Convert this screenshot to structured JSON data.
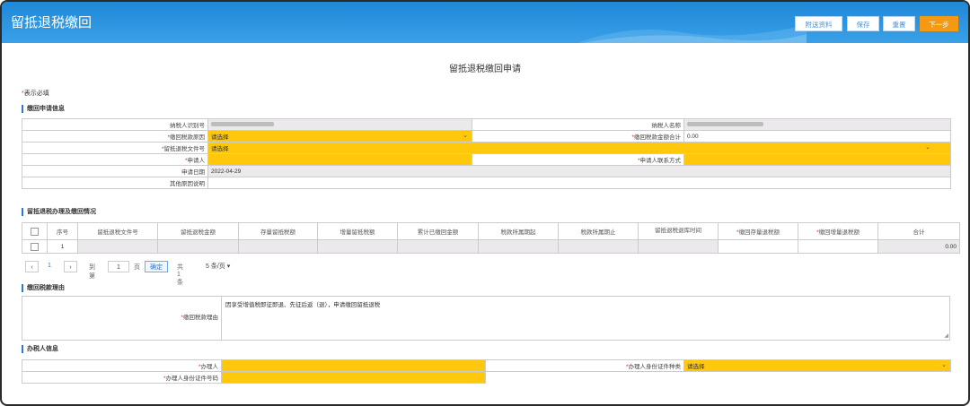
{
  "app_title": "留抵退税缴回",
  "toolbar": {
    "attach": "附送资料",
    "save": "保存",
    "reset": "重置",
    "next": "下一步"
  },
  "page_title": "留抵退税缴回申请",
  "required_note_star": "*",
  "required_note": "表示必填",
  "sections": {
    "apply_info": "缴回申请信息",
    "handling": "留抵退税办理及缴回情况",
    "reason": "缴回税款理由",
    "handler": "办税人信息"
  },
  "apply_form": {
    "taxpayer_id_label": "纳税人识别号",
    "taxpayer_name_label": "纳税人名称",
    "reason_type_label": "缴回税款原因",
    "reason_type_value": "请选择",
    "total_label": "缴回税款金额合计",
    "total_value": "0.00",
    "doc_no_label": "留抵退税文件号",
    "doc_no_value": "请选择",
    "applicant_label": "申请人",
    "contact_label": "申请人联系方式",
    "date_label": "申请日期",
    "date_value": "2022-04-29",
    "other_label": "其他原因说明"
  },
  "grid": {
    "headers": [
      "序号",
      "留抵退税文件号",
      "留抵退税金额",
      "存量留抵税额",
      "增量留抵税额",
      "累计已缴回金额",
      "税款所属期起",
      "税款所属期止",
      "留抵退税退库时间",
      "缴回存量退税额",
      "缴回增量退税额",
      "合计"
    ],
    "rows": [
      {
        "seq": "1",
        "total": "0.00"
      }
    ]
  },
  "pager": {
    "current": "1",
    "goto_label": "到第",
    "page_input": "1",
    "page_unit": "页",
    "confirm": "确定",
    "total": "共1条",
    "page_size": "5 条/页"
  },
  "reason": {
    "label": "缴回税款理由",
    "value": "因享受增值税即征即退、先征后返（退），申请缴回留抵退税"
  },
  "handler_form": {
    "handler_label": "办理人",
    "id_type_label": "办理人身份证件种类",
    "id_type_value": "请选择",
    "id_no_label": "办理人身份证件号码"
  },
  "colors": {
    "header_blue": "#1e88d8",
    "required_yellow": "#ffc80a",
    "next_orange": "#f39a12"
  }
}
